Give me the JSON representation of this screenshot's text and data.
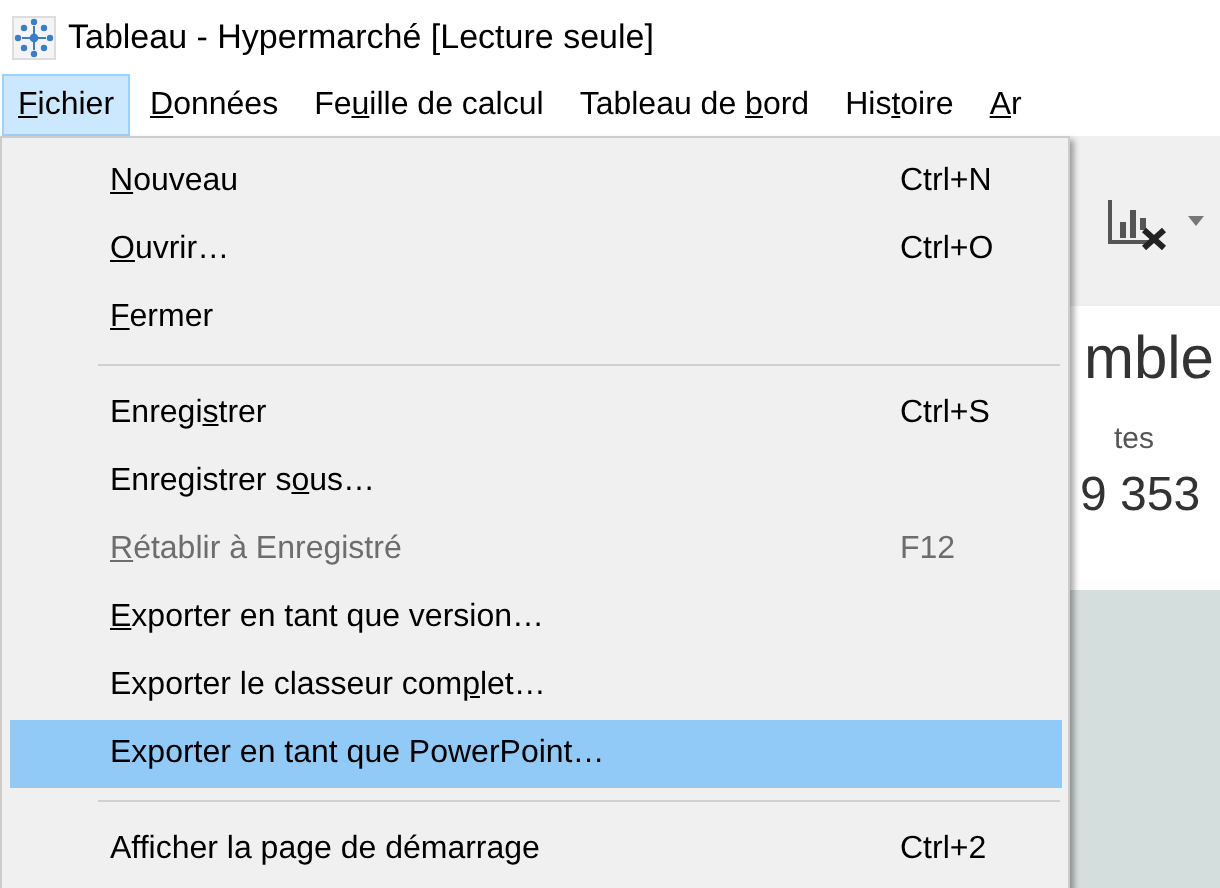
{
  "window": {
    "title": "Tableau - Hypermarché [Lecture seule]"
  },
  "menubar": [
    {
      "label": {
        "key": "F",
        "post": "ichier"
      },
      "selected": true
    },
    {
      "label": {
        "key": "D",
        "post": "onnées"
      },
      "selected": false
    },
    {
      "label": {
        "pre": "Fe",
        "key": "u",
        "post": "ille de calcul"
      },
      "selected": false
    },
    {
      "label": {
        "pre": "Tableau de ",
        "key": "b",
        "post": "ord"
      },
      "selected": false
    },
    {
      "label": {
        "pre": "His",
        "key": "t",
        "post": "oire"
      },
      "selected": false
    },
    {
      "label": {
        "key": "A",
        "post": "r"
      },
      "selected": false
    }
  ],
  "background": {
    "heading": "mble",
    "caption": "tes",
    "value": "9 353"
  },
  "menu": [
    {
      "kind": "item",
      "label": {
        "key": "N",
        "post": "ouveau"
      },
      "shortcut": "Ctrl+N",
      "disabled": false,
      "selected": false
    },
    {
      "kind": "item",
      "label": {
        "key": "O",
        "post": "uvrir…"
      },
      "shortcut": "Ctrl+O",
      "disabled": false,
      "selected": false
    },
    {
      "kind": "item",
      "label": {
        "key": "F",
        "post": "ermer"
      },
      "disabled": false,
      "selected": false
    },
    {
      "kind": "separator"
    },
    {
      "kind": "item",
      "label": {
        "pre": "Enregi",
        "key": "s",
        "post": "trer"
      },
      "shortcut": "Ctrl+S",
      "disabled": false,
      "selected": false
    },
    {
      "kind": "item",
      "label": {
        "pre": "Enregistrer s",
        "key": "o",
        "post": "us…"
      },
      "disabled": false,
      "selected": false
    },
    {
      "kind": "item",
      "label": {
        "key": "R",
        "post": "établir à Enregistré"
      },
      "shortcut": "F12",
      "disabled": true,
      "selected": false
    },
    {
      "kind": "item",
      "label": {
        "key": "E",
        "post": "xporter en tant que version…"
      },
      "disabled": false,
      "selected": false
    },
    {
      "kind": "item",
      "label": {
        "pre": "Exporter le classeur com",
        "key": "p",
        "post": "let…"
      },
      "disabled": false,
      "selected": false
    },
    {
      "kind": "item",
      "label": {
        "pre": "Exporter en tant que PowerPoint…"
      },
      "disabled": false,
      "selected": true
    },
    {
      "kind": "separator"
    },
    {
      "kind": "item",
      "label": {
        "pre": "Afficher la page de démarrage"
      },
      "shortcut": "Ctrl+2",
      "disabled": false,
      "selected": false
    }
  ]
}
